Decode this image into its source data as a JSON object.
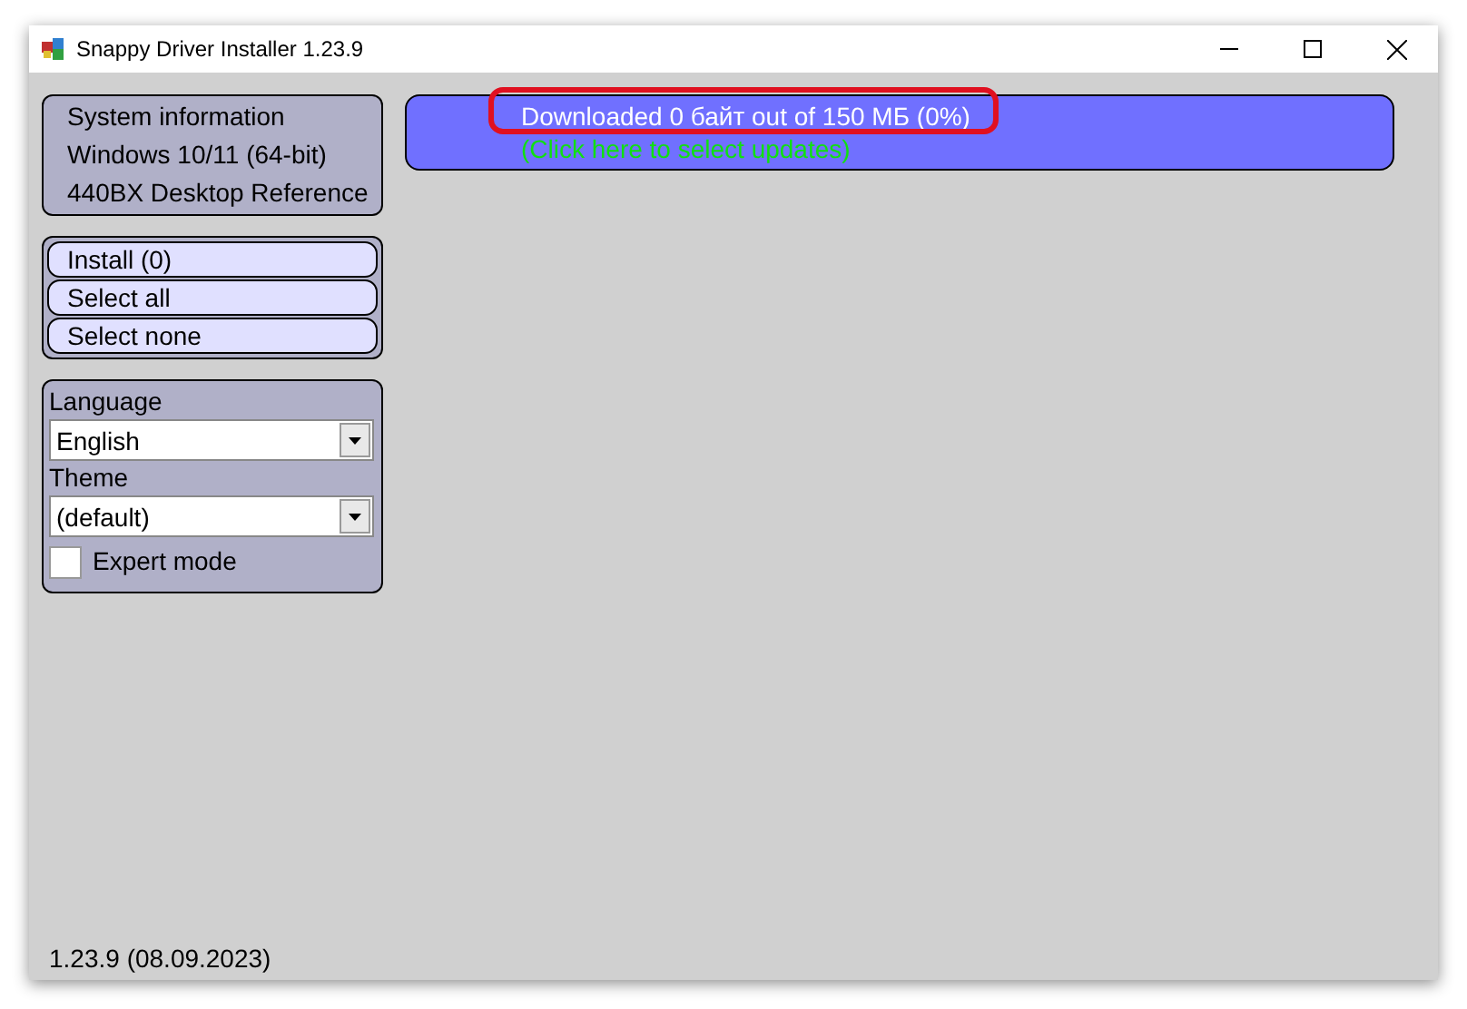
{
  "window": {
    "title": "Snappy Driver Installer 1.23.9"
  },
  "system_info": [
    "System information",
    "Windows 10/11 (64-bit)",
    "440BX Desktop Reference"
  ],
  "actions": [
    "Install (0)",
    "Select all",
    "Select none"
  ],
  "settings": {
    "language_label": "Language",
    "language": "English",
    "theme_label": "Theme",
    "theme": "(default)",
    "expert_mode": {
      "label": "Expert mode",
      "checked": false
    }
  },
  "banner": {
    "status": "Downloaded 0 байт out of 150 МБ (0%)",
    "link": "(Click here to select updates)",
    "highlighted": true
  },
  "version": "1.23.9 (08.09.2023)"
}
